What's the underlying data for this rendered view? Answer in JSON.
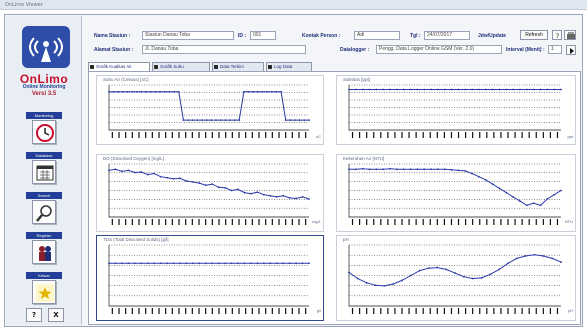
{
  "window": {
    "title": "OnLimo Viewer"
  },
  "brand": {
    "name": "OnLimo",
    "tagline": "Online Monitoring",
    "version": "Versi 3.5"
  },
  "sidebar": {
    "items": [
      {
        "label": "Monitoring",
        "icon": "clock-icon"
      },
      {
        "label": "Database",
        "icon": "calendar-icon"
      },
      {
        "label": "Search",
        "icon": "magnifier-icon"
      },
      {
        "label": "Register",
        "icon": "people-icon"
      },
      {
        "label": "Keluar",
        "icon": "star-icon"
      }
    ],
    "help_label": "?",
    "exit_label": "X"
  },
  "header": {
    "station_name_label": "Nama Stasiun :",
    "station_name_value": "Stasiun Danau Toba",
    "id_label": "ID :",
    "id_value": "001",
    "contact_label": "Kontak Person :",
    "contact_value": "Adi",
    "date_label": "Tgl :",
    "date_value": "24/07/2017",
    "live_label": "Jdw/Update",
    "live_btn": "Refresh",
    "location_label": "Alamat Stasiun :",
    "location_value": "Jl. Danau Toba",
    "datalogger_label": "Datalogger :",
    "datalogger_value": "Pengg. Data Logger Online GSM (Ver. 2.0)",
    "interval_label": "Interval (Menit) :",
    "interval_value": "1"
  },
  "tabs": [
    {
      "label": "Grafik Kualitas Air",
      "checked": true,
      "active": true
    },
    {
      "label": "Grafik Suhu",
      "checked": true
    },
    {
      "label": "Data Terkini",
      "checked": true
    },
    {
      "label": "Log Data",
      "checked": true
    }
  ],
  "charts": [
    {
      "title": "Suhu Air (Celsius) [oC]",
      "unit": "oC"
    },
    {
      "title": "Salinitas [ppt]",
      "unit": "ppt"
    },
    {
      "title": "DO (Dissolved Oxygen) [mg/L]",
      "unit": "mg/L"
    },
    {
      "title": "Kekeruhan Air [NTU]",
      "unit": "NTU"
    },
    {
      "title": "TDS (Total Dissolved Solids) [g/l]",
      "unit": "g/l"
    },
    {
      "title": "pH",
      "unit": "pH"
    }
  ],
  "chart_data": [
    {
      "type": "line",
      "series": [
        {
          "values": [
            0.85,
            0.85,
            0.85,
            0.85,
            0.85,
            0.85,
            0.85,
            0.85,
            0.85,
            0.85,
            0.85,
            0.85,
            0.85,
            0.85,
            0.85,
            0.85,
            0.22,
            0.22,
            0.22,
            0.22,
            0.22,
            0.22,
            0.22,
            0.22,
            0.22,
            0.22,
            0.22,
            0.22,
            0.22,
            0.85,
            0.85,
            0.85,
            0.85,
            0.85,
            0.85,
            0.85,
            0.85,
            0.85,
            0.22,
            0.22,
            0.22,
            0.22,
            0.22,
            0.22
          ]
        }
      ],
      "color": "#2a3aa8"
    },
    {
      "type": "line",
      "series": [
        {
          "values": [
            0.9,
            0.9,
            0.9,
            0.9,
            0.9,
            0.9,
            0.9,
            0.9,
            0.9,
            0.9,
            0.9,
            0.9,
            0.9,
            0.9,
            0.9,
            0.9,
            0.9,
            0.9,
            0.9,
            0.9,
            0.9,
            0.9,
            0.9,
            0.9,
            0.9,
            0.9,
            0.9,
            0.9,
            0.9,
            0.9,
            0.9,
            0.9
          ]
        }
      ],
      "color": "#2a3aa8"
    },
    {
      "type": "line",
      "series": [
        {
          "values": [
            0.88,
            0.9,
            0.86,
            0.88,
            0.84,
            0.85,
            0.8,
            0.82,
            0.76,
            0.74,
            0.72,
            0.73,
            0.68,
            0.66,
            0.64,
            0.6,
            0.62,
            0.56,
            0.55,
            0.5,
            0.52,
            0.46,
            0.44,
            0.47,
            0.42,
            0.4,
            0.38,
            0.4,
            0.36,
            0.35,
            0.38,
            0.34
          ]
        }
      ],
      "color": "#2a3aa8"
    },
    {
      "type": "line",
      "series": [
        {
          "values": [
            0.9,
            0.9,
            0.91,
            0.9,
            0.9,
            0.9,
            0.91,
            0.9,
            0.9,
            0.9,
            0.9,
            0.9,
            0.9,
            0.9,
            0.9,
            0.89,
            0.88,
            0.87,
            0.82,
            0.76,
            0.7,
            0.62,
            0.54,
            0.46,
            0.38,
            0.3,
            0.22,
            0.26,
            0.22,
            0.34,
            0.42,
            0.5
          ]
        }
      ],
      "color": "#2a3aa8"
    },
    {
      "type": "line",
      "series": [
        {
          "values": [
            0.7,
            0.7,
            0.7,
            0.7,
            0.7,
            0.7,
            0.7,
            0.7,
            0.7,
            0.7,
            0.7,
            0.7,
            0.7,
            0.7,
            0.7,
            0.7,
            0.7,
            0.7,
            0.7,
            0.7,
            0.7,
            0.7,
            0.7,
            0.7,
            0.7,
            0.7,
            0.7,
            0.7,
            0.7,
            0.7,
            0.7,
            0.7
          ]
        }
      ],
      "color": "#2a3aa8"
    },
    {
      "type": "line",
      "series": [
        {
          "values": [
            0.55,
            0.45,
            0.38,
            0.34,
            0.33,
            0.36,
            0.42,
            0.5,
            0.58,
            0.62,
            0.63,
            0.6,
            0.54,
            0.48,
            0.45,
            0.46,
            0.52,
            0.6,
            0.7,
            0.78,
            0.82,
            0.84,
            0.82,
            0.78,
            0.72
          ]
        }
      ],
      "color": "#2a3aa8"
    }
  ]
}
